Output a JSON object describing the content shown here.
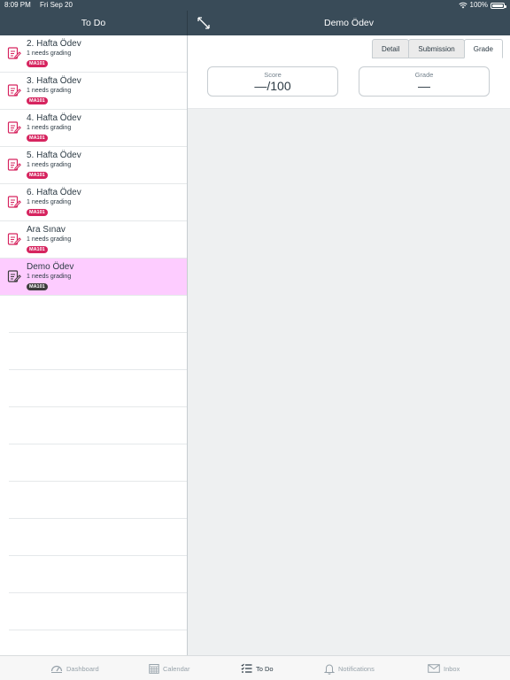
{
  "status_bar": {
    "time": "8:09 PM",
    "date": "Fri Sep 20",
    "battery": "100%"
  },
  "left_nav": {
    "title": "To Do"
  },
  "right_nav": {
    "title": "Demo Ödev"
  },
  "todo_items": [
    {
      "title": "2. Hafta Ödev",
      "subtitle": "1 needs grading",
      "badge": "MA101"
    },
    {
      "title": "3. Hafta Ödev",
      "subtitle": "1 needs grading",
      "badge": "MA101"
    },
    {
      "title": "4. Hafta Ödev",
      "subtitle": "1 needs grading",
      "badge": "MA101"
    },
    {
      "title": "5. Hafta Ödev",
      "subtitle": "1 needs grading",
      "badge": "MA101"
    },
    {
      "title": "6. Hafta Ödev",
      "subtitle": "1 needs grading",
      "badge": "MA101"
    },
    {
      "title": "Ara Sınav",
      "subtitle": "1 needs grading",
      "badge": "MA101"
    },
    {
      "title": "Demo Ödev",
      "subtitle": "1 needs grading",
      "badge": "MA101",
      "selected": true
    }
  ],
  "detail_tabs": [
    {
      "label": "Detail"
    },
    {
      "label": "Submission"
    },
    {
      "label": "Grade",
      "active": true
    }
  ],
  "grade_panel": {
    "score_label": "Score",
    "score_value": "—/100",
    "grade_label": "Grade",
    "grade_value": "—"
  },
  "tab_bar": [
    {
      "label": "Dashboard",
      "icon": "dashboard-icon"
    },
    {
      "label": "Calendar",
      "icon": "calendar-icon"
    },
    {
      "label": "To Do",
      "icon": "todo-icon",
      "active": true
    },
    {
      "label": "Notifications",
      "icon": "bell-icon"
    },
    {
      "label": "Inbox",
      "icon": "envelope-icon"
    }
  ],
  "colors": {
    "nav": "#394b58",
    "badge": "#d6245f",
    "selected_row": "#fdccff",
    "assignment_icon": "#d6245f"
  }
}
